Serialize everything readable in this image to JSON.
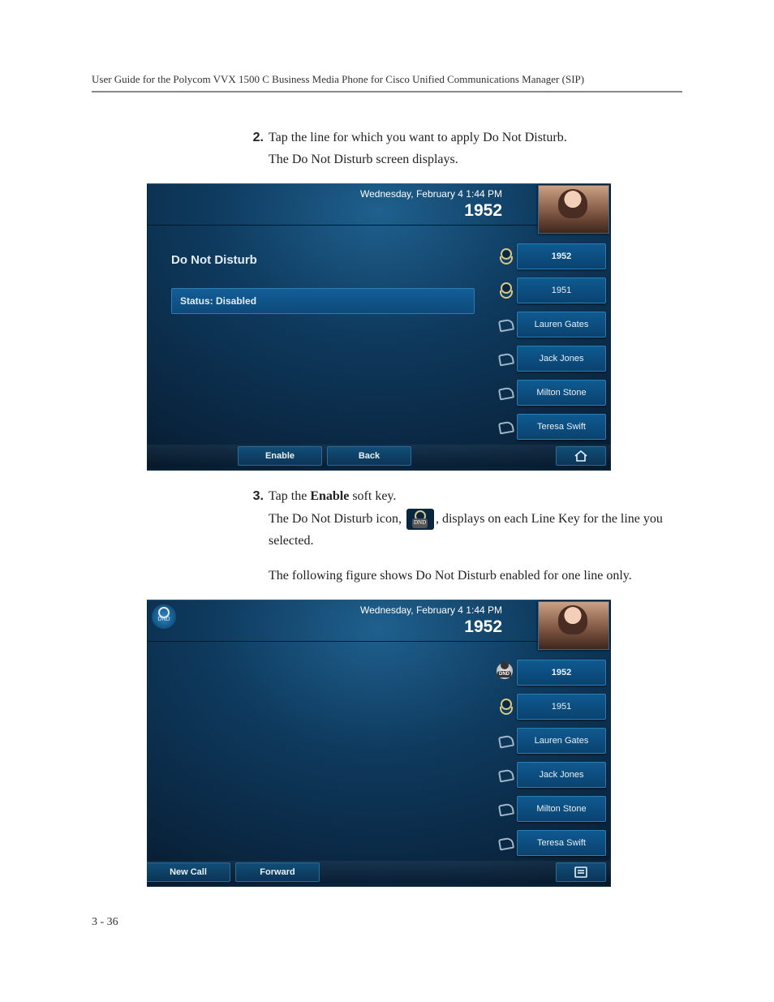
{
  "header": "User Guide for the Polycom VVX 1500 C Business Media Phone for Cisco Unified Communications Manager (SIP)",
  "steps": {
    "s2": {
      "num": "2.",
      "line1": "Tap the line for which you want to apply Do Not Disturb.",
      "line2": "The Do Not Disturb screen displays."
    },
    "s3": {
      "num": "3.",
      "line1a": "Tap the ",
      "line1b": "Enable",
      "line1c": " soft key.",
      "line2a": "The Do Not Disturb icon, ",
      "line2b": ", displays on each Line Key for the line you selected.",
      "line3": "The following figure shows Do Not Disturb enabled for one line only."
    }
  },
  "screen1": {
    "datetime": "Wednesday, February 4   1:44 PM",
    "ext": "1952",
    "title": "Do Not Disturb",
    "status": "Status: Disabled",
    "softkeys": {
      "k1": "Enable",
      "k2": "Back"
    },
    "lines": {
      "l1": "1952",
      "l2": "1951",
      "l3": "Lauren Gates",
      "l4": "Jack Jones",
      "l5": "Milton Stone",
      "l6": "Teresa Swift"
    }
  },
  "screen2": {
    "datetime": "Wednesday, February 4   1:44 PM",
    "ext": "1952",
    "softkeys": {
      "k1": "New Call",
      "k2": "Forward"
    },
    "lines": {
      "l1": "1952",
      "l2": "1951",
      "l3": "Lauren Gates",
      "l4": "Jack Jones",
      "l5": "Milton Stone",
      "l6": "Teresa Swift"
    }
  },
  "footer": "3 - 36"
}
